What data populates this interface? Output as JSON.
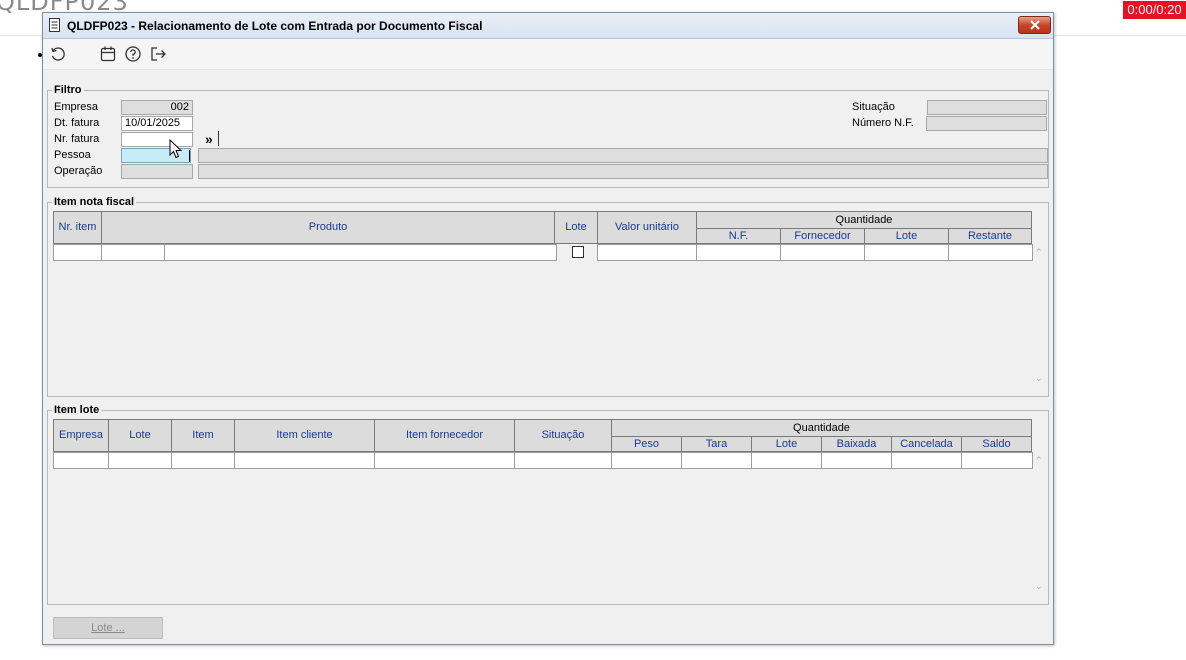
{
  "background": {
    "title": "QLDFP023",
    "timer": "0:00/0:20"
  },
  "window": {
    "title": "QLDFP023 - Relacionamento de Lote com Entrada por Documento Fiscal"
  },
  "toolbar": {
    "icons": [
      "refresh-icon",
      "calendar-icon",
      "help-icon",
      "exit-icon"
    ]
  },
  "filtro": {
    "legend": "Filtro",
    "empresa_label": "Empresa",
    "empresa_value": "002",
    "dt_fatura_label": "Dt. fatura",
    "dt_fatura_value": "10/01/2025",
    "nr_fatura_label": "Nr. fatura",
    "nr_fatura_value": "",
    "lookup_button": "»",
    "pessoa_label": "Pessoa",
    "pessoa_value": "",
    "operacao_label": "Operação",
    "operacao_value": "",
    "situacao_label": "Situação",
    "situacao_value": "",
    "numero_nf_label": "Número N.F.",
    "numero_nf_value": ""
  },
  "item_nota": {
    "legend": "Item nota fiscal",
    "headers": {
      "nr_item": "Nr. item",
      "produto": "Produto",
      "lote": "Lote",
      "valor_unitario": "Valor unitário",
      "quantidade": "Quantidade",
      "nf": "N.F.",
      "fornecedor": "Fornecedor",
      "q_lote": "Lote",
      "restante": "Restante"
    },
    "row": {
      "lote_checked": false
    }
  },
  "item_lote": {
    "legend": "Item lote",
    "headers": {
      "empresa": "Empresa",
      "lote": "Lote",
      "item": "Item",
      "item_cliente": "Item cliente",
      "item_fornecedor": "Item fornecedor",
      "situacao": "Situação",
      "quantidade": "Quantidade",
      "peso": "Peso",
      "tara": "Tara",
      "q_lote": "Lote",
      "baixada": "Baixada",
      "cancelada": "Cancelada",
      "saldo": "Saldo"
    }
  },
  "footer": {
    "lote_button": "Lote ..."
  },
  "colors": {
    "header_text": "#1a3a8a",
    "focus_field": "#c8ecf7",
    "close_button": "#c9452a"
  }
}
